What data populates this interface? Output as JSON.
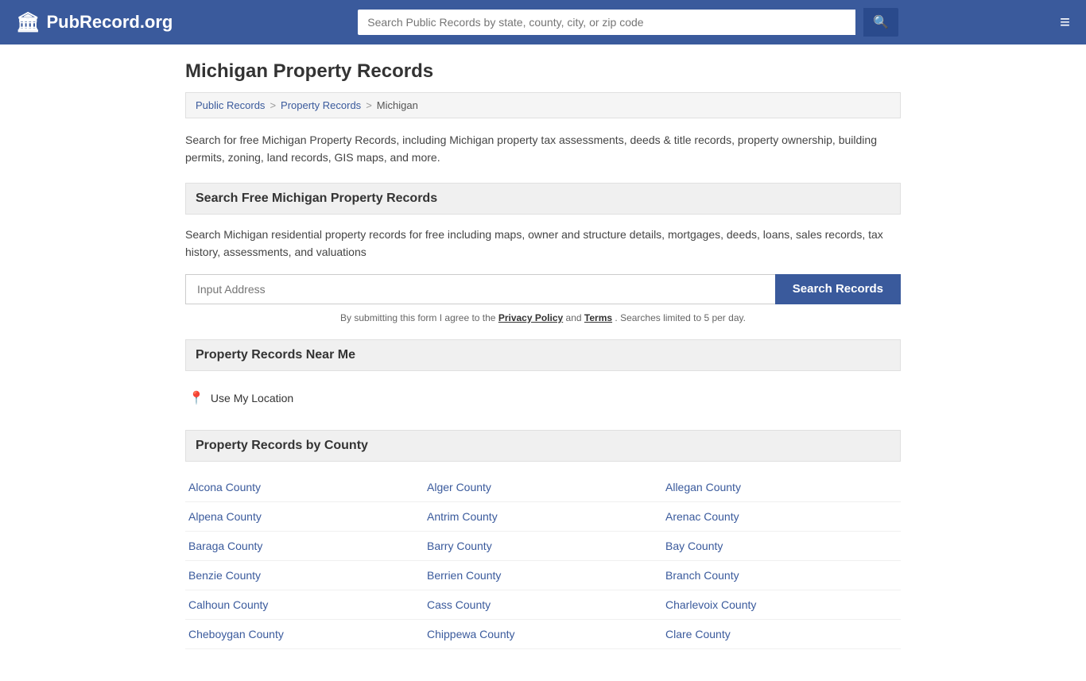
{
  "header": {
    "logo_icon": "🏛",
    "logo_text": "PubRecord.org",
    "search_placeholder": "Search Public Records by state, county, city, or zip code",
    "search_button_icon": "🔍",
    "menu_icon": "≡"
  },
  "page": {
    "title": "Michigan Property Records",
    "breadcrumb": {
      "items": [
        "Public Records",
        "Property Records",
        "Michigan"
      ],
      "separators": [
        ">",
        ">"
      ]
    },
    "description": "Search for free Michigan Property Records, including Michigan property tax assessments, deeds & title records, property ownership, building permits, zoning, land records, GIS maps, and more.",
    "search_section": {
      "heading": "Search Free Michigan Property Records",
      "section_desc": "Search Michigan residential property records for free including maps, owner and structure details, mortgages, deeds, loans, sales records, tax history, assessments, and valuations",
      "input_placeholder": "Input Address",
      "button_label": "Search Records",
      "notice_prefix": "By submitting this form I agree to the",
      "privacy_label": "Privacy Policy",
      "notice_and": "and",
      "terms_label": "Terms",
      "notice_suffix": ". Searches limited to 5 per day."
    },
    "near_me_section": {
      "heading": "Property Records Near Me",
      "location_label": "Use My Location",
      "location_icon": "📍"
    },
    "county_section": {
      "heading": "Property Records by County",
      "counties": [
        "Alcona County",
        "Alger County",
        "Allegan County",
        "Alpena County",
        "Antrim County",
        "Arenac County",
        "Baraga County",
        "Barry County",
        "Bay County",
        "Benzie County",
        "Berrien County",
        "Branch County",
        "Calhoun County",
        "Cass County",
        "Charlevoix County",
        "Cheboygan County",
        "Chippewa County",
        "Clare County"
      ]
    }
  }
}
